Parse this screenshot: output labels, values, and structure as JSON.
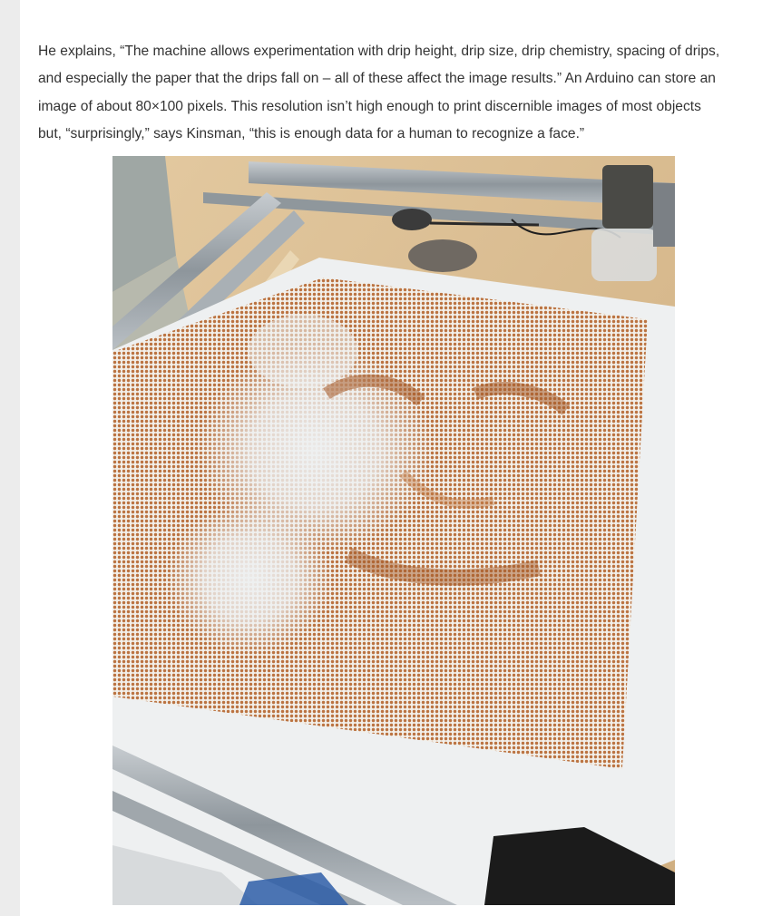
{
  "article": {
    "paragraph_lines": [
      "He explains, “The machine allows experimentation with drip height, drip size, drip chemistry, spacing of drips,",
      "and especially the paper that the drips fall on – all of these affect the image results.” An Arduino can store an",
      "image of about 80×100 pixels. This resolution isn’t high enough to print discernible images of most objects",
      "but, “surprisingly,” says Kinsman, “this is enough data for a human to recognize a face.”"
    ]
  },
  "photo": {
    "subject": "drip-portrait-machine-photo",
    "colors": {
      "table": "#d8b88c",
      "paper": "#eef0f1",
      "ink": "#b5652e",
      "rail": "#9aa2a8"
    }
  }
}
